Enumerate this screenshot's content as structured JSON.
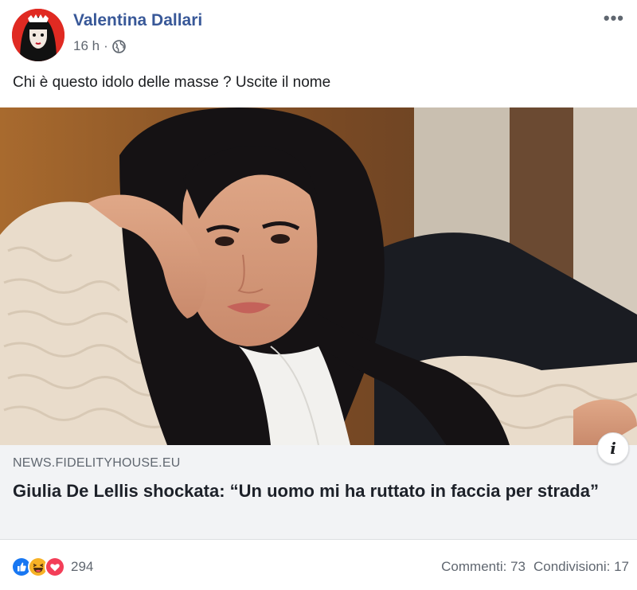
{
  "post": {
    "author": "Valentina Dallari",
    "time": "16 h",
    "separator": "·",
    "privacy_icon": "globe-icon",
    "more_icon": "more-options-icon",
    "more_label": "•••",
    "text": "Chi è questo idolo delle masse ? Uscite il nome"
  },
  "link_card": {
    "domain": "NEWS.FIDELITYHOUSE.EU",
    "headline": "Giulia De Lellis shockata: “Un uomo mi ha ruttato in faccia per strada”",
    "info_label": "i"
  },
  "footer": {
    "reactions": [
      "like-icon",
      "haha-icon",
      "love-icon"
    ],
    "reaction_count": "294",
    "comments": "Commenti: 73",
    "shares": "Condivisioni: 17"
  },
  "colors": {
    "author_blue": "#385898",
    "like_blue": "#1877f2",
    "haha_yellow": "#f7b125",
    "love_red": "#f33e58",
    "card_bg": "#f2f3f5"
  }
}
